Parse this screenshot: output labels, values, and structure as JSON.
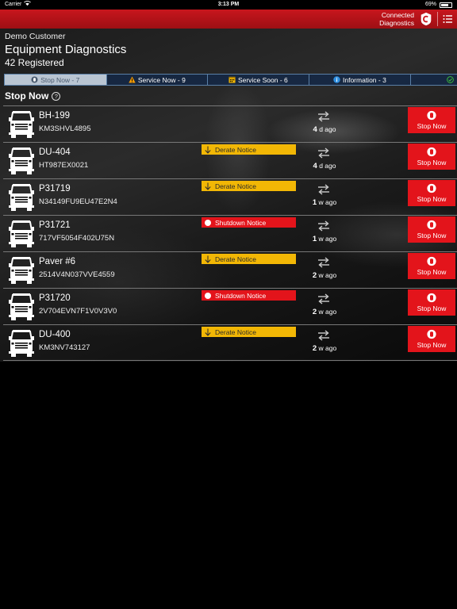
{
  "statusbar": {
    "carrier": "Carrier",
    "time": "3:13 PM",
    "battery": "69%"
  },
  "appbar": {
    "brand_line1": "Connected",
    "brand_line2": "Diagnostics",
    "logo_icon": "cummins-logo-icon",
    "menu_icon": "list-menu-icon"
  },
  "header": {
    "customer": "Demo Customer",
    "title": "Equipment Diagnostics",
    "registered": "42 Registered"
  },
  "tabs": [
    {
      "label": "Stop Now - 7",
      "icon": "stop-icon",
      "active": true
    },
    {
      "label": "Service Now - 9",
      "icon": "warning-icon"
    },
    {
      "label": "Service Soon - 6",
      "icon": "calendar-icon"
    },
    {
      "label": "Information - 3",
      "icon": "info-icon"
    },
    {
      "label": "",
      "icon": "check-circle-icon"
    }
  ],
  "section": {
    "title": "Stop Now",
    "help": "?"
  },
  "rows": [
    {
      "name": "BH-199",
      "vin": "KM3SHVL4895",
      "notice": "",
      "notice_type": "",
      "ago_num": "4",
      "ago_unit": "d ago",
      "stop": "Stop Now"
    },
    {
      "name": "DU-404",
      "vin": "HT987EX0021",
      "notice": "Derate Notice",
      "notice_type": "derate",
      "ago_num": "4",
      "ago_unit": "d ago",
      "stop": "Stop Now"
    },
    {
      "name": "P31719",
      "vin": "N34149FU9EU47E2N4",
      "notice": "Derate Notice",
      "notice_type": "derate",
      "ago_num": "1",
      "ago_unit": "w ago",
      "stop": "Stop Now"
    },
    {
      "name": "P31721",
      "vin": "717VF5054F402U75N",
      "notice": "Shutdown Notice",
      "notice_type": "shutdown",
      "ago_num": "1",
      "ago_unit": "w ago",
      "stop": "Stop Now"
    },
    {
      "name": "Paver #6",
      "vin": "2514V4N037VVE4559",
      "notice": "Derate Notice",
      "notice_type": "derate",
      "ago_num": "2",
      "ago_unit": "w ago",
      "stop": "Stop Now"
    },
    {
      "name": "P31720",
      "vin": "2V704EVN7F1V0V3V0",
      "notice": "Shutdown Notice",
      "notice_type": "shutdown",
      "ago_num": "2",
      "ago_unit": "w ago",
      "stop": "Stop Now"
    },
    {
      "name": "DU-400",
      "vin": "KM3NV743127",
      "notice": "Derate Notice",
      "notice_type": "derate",
      "ago_num": "2",
      "ago_unit": "w ago",
      "stop": "Stop Now"
    }
  ],
  "colors": {
    "brand_red": "#c8161d",
    "stop_red": "#e3141b",
    "derate_yellow": "#f2b705",
    "tab_bg": "#142846",
    "tab_active": "#b9c5d2"
  }
}
